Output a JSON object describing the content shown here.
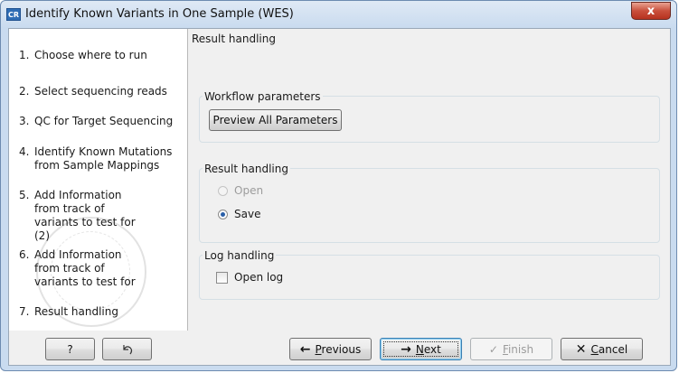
{
  "window": {
    "app_icon": "CR",
    "title": "Identify Known Variants in One Sample (WES)",
    "close_icon": "close-icon",
    "close_glyph": "x"
  },
  "steps": [
    {
      "num": "1.",
      "label": "Choose where to run"
    },
    {
      "num": "2.",
      "label": "Select sequencing reads"
    },
    {
      "num": "3.",
      "label": "QC for Target Sequencing"
    },
    {
      "num": "4.",
      "label": "Identify Known Mutations from Sample Mappings"
    },
    {
      "num": "5.",
      "label": "Add Information from track of variants to test for (2)"
    },
    {
      "num": "6.",
      "label": "Add Information from track of variants to test for"
    },
    {
      "num": "7.",
      "label": "Result handling"
    }
  ],
  "content": {
    "title": "Result handling",
    "workflow_parameters": {
      "group_title": "Workflow parameters",
      "button_label": "Preview All Parameters"
    },
    "result_handling": {
      "group_title": "Result handling",
      "options": [
        {
          "label": "Open",
          "checked": false,
          "disabled": true
        },
        {
          "label": "Save",
          "checked": true,
          "disabled": false
        }
      ]
    },
    "log_handling": {
      "group_title": "Log handling",
      "checkbox_label": "Open log",
      "checked": false
    }
  },
  "footer": {
    "help_label": "?",
    "reset_icon": "undo-icon",
    "previous": {
      "arrow": "←",
      "label_first": "P",
      "label_rest": "revious"
    },
    "next": {
      "arrow": "→",
      "label_first": "N",
      "label_rest": "ext"
    },
    "finish": {
      "icon": "✓",
      "label_first": "F",
      "label_rest": "inish",
      "disabled": true
    },
    "cancel": {
      "icon": "✕",
      "label_first": "C",
      "label_rest": "ancel"
    }
  },
  "colors": {
    "accent": "#2a5fa8",
    "title_bar": "#c9dbef",
    "close_button": "#c9503c"
  }
}
